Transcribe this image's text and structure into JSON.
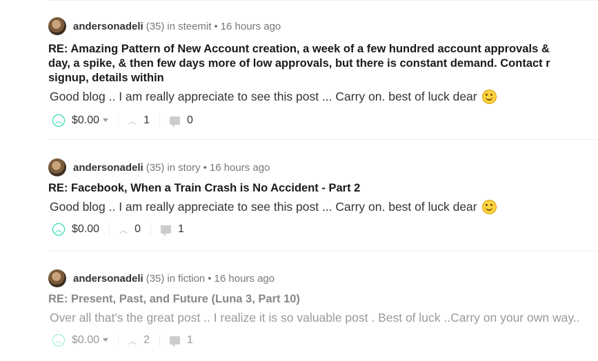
{
  "posts": [
    {
      "author": "andersonadeli",
      "reputation": "(35)",
      "in_label": "in",
      "category": "steemit",
      "time": "16 hours ago",
      "title_lines": [
        "RE: Amazing Pattern of New Account creation, a week of a few hundred account approvals &",
        "day, a spike, & then few days more of low approvals, but there is constant demand. Contact r",
        "signup, details within"
      ],
      "body": "Good blog .. I am really appreciate to see this post ... Carry on. best of luck dear",
      "payout": "$0.00",
      "votes": "1",
      "comments": "0"
    },
    {
      "author": "andersonadeli",
      "reputation": "(35)",
      "in_label": "in",
      "category": "story",
      "time": "16 hours ago",
      "title": "RE: Facebook, When a Train Crash is No Accident - Part 2",
      "body": "Good blog .. I am really appreciate to see this post ... Carry on. best of luck dear",
      "payout": "$0.00",
      "votes": "0",
      "comments": "1"
    },
    {
      "author": "andersonadeli",
      "reputation": "(35)",
      "in_label": "in",
      "category": "fiction",
      "time": "16 hours ago",
      "title": "RE: Present, Past, and Future (Luna 3, Part 10)",
      "body": "Over all that's the great post .. I realize it is so valuable post . Best of luck ..Carry on your own way..",
      "payout": "$0.00",
      "votes": "2",
      "comments": "1"
    }
  ],
  "separator": "•",
  "icons": {
    "avatar": "user-avatar",
    "upvote": "upvote-chevron-icon",
    "dropdown": "caret-down-icon",
    "votes": "vote-count-icon",
    "comments": "comment-icon",
    "emoji": "smiling-face-icon"
  },
  "colors": {
    "accent": "#07d7a9"
  }
}
